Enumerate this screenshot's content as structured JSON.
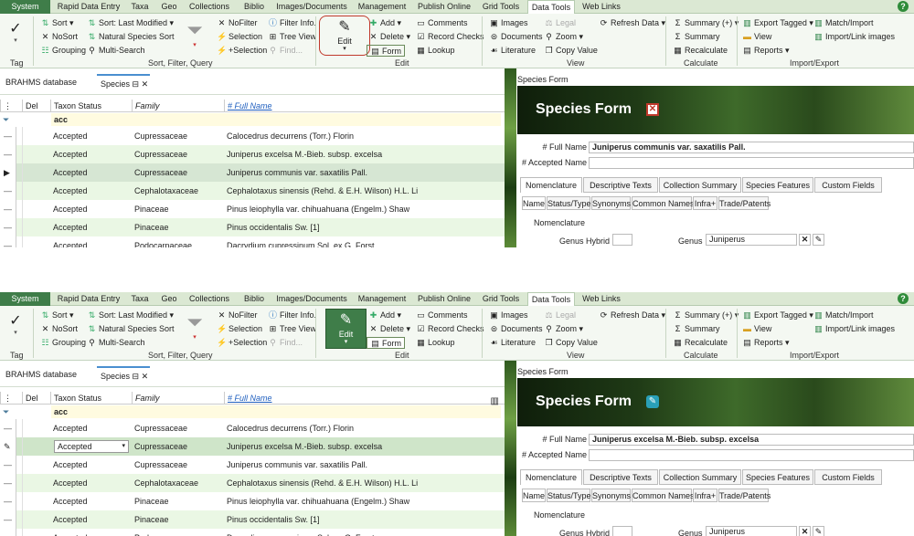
{
  "ribbon_tabs": [
    "System",
    "Rapid Data Entry",
    "Taxa",
    "Geo",
    "Collections",
    "Biblio",
    "Images/Documents",
    "Management",
    "Publish Online",
    "Grid Tools",
    "Data Tools",
    "Web Links"
  ],
  "help": "?",
  "ribbon": {
    "tag": {
      "label": "Tag",
      "group": "Tag"
    },
    "sort": {
      "sort": "Sort",
      "nosort": "NoSort",
      "grouping": "Grouping",
      "sort_last": "Sort: Last Modified",
      "natural": "Natural Species Sort",
      "multi": "Multi-Search",
      "nofilter": "NoFilter",
      "selection": "Selection",
      "plus_selection": "+Selection",
      "filter_info": "Filter Info.",
      "tree_view": "Tree View",
      "find": "Find...",
      "group": "Sort, Filter, Query"
    },
    "edit": {
      "edit": "Edit",
      "add": "Add",
      "delete": "Delete",
      "form": "Form",
      "comments": "Comments",
      "record_checks": "Record Checks",
      "lookup": "Lookup",
      "group": "Edit"
    },
    "view": {
      "images": "Images",
      "documents": "Documents",
      "literature": "Literature",
      "legal": "Legal",
      "zoom": "Zoom",
      "copy_value": "Copy Value",
      "group": "View"
    },
    "calc": {
      "refresh": "Refresh Data",
      "summary_plus": "Summary (+)",
      "summary": "Summary",
      "recalculate": "Recalculate",
      "group": "Calculate"
    },
    "io": {
      "export": "Export Tagged",
      "view": "View",
      "reports": "Reports",
      "match": "Match/Import",
      "import_images": "Import/Link images",
      "group": "Import/Export"
    }
  },
  "doc_tabs": {
    "db": "BRAHMS database",
    "species": "Species"
  },
  "grid": {
    "headers": {
      "del": "Del",
      "status": "Taxon Status",
      "family": "Family",
      "fullname": "# Full Name"
    },
    "filter": "acc",
    "rows": [
      {
        "status": "Accepted",
        "family": "Cupressaceae",
        "name": "Calocedrus decurrens (Torr.) Florin"
      },
      {
        "status": "Accepted",
        "family": "Cupressaceae",
        "name": "Juniperus excelsa M.-Bieb. subsp. excelsa"
      },
      {
        "status": "Accepted",
        "family": "Cupressaceae",
        "name": "Juniperus communis var. saxatilis Pall."
      },
      {
        "status": "Accepted",
        "family": "Cephalotaxaceae",
        "name": "Cephalotaxus sinensis (Rehd. & E.H. Wilson) H.L. Li"
      },
      {
        "status": "Accepted",
        "family": "Pinaceae",
        "name": "Pinus leiophylla var. chihuahuana (Engelm.) Shaw"
      },
      {
        "status": "Accepted",
        "family": "Pinaceae",
        "name": "Pinus occidentalis Sw. [1]"
      },
      {
        "status": "Accepted",
        "family": "Podocarpaceae",
        "name": "Dacrydium cupressinum Sol. ex G. Forst."
      }
    ],
    "edit_value": "Accepted"
  },
  "form": {
    "header": "Species Form",
    "banner": "Species Form",
    "labels": {
      "fullname": "# Full Name",
      "accepted": "# Accepted Name"
    },
    "value_a": "Juniperus communis var. saxatilis Pall.",
    "value_b": "Juniperus excelsa M.-Bieb. subsp. excelsa",
    "tabs": [
      "Nomenclature",
      "Descriptive Texts",
      "Collection Summary",
      "Species Features",
      "Custom Fields"
    ],
    "subtabs": [
      "Name",
      "Status/Type",
      "Synonyms",
      "Common Names",
      "Infra+",
      "Trade/Patents"
    ],
    "section": "Nomenclature",
    "genus_hybrid": "Genus Hybrid",
    "genus_label": "Genus",
    "genus_value": "Juniperus"
  }
}
